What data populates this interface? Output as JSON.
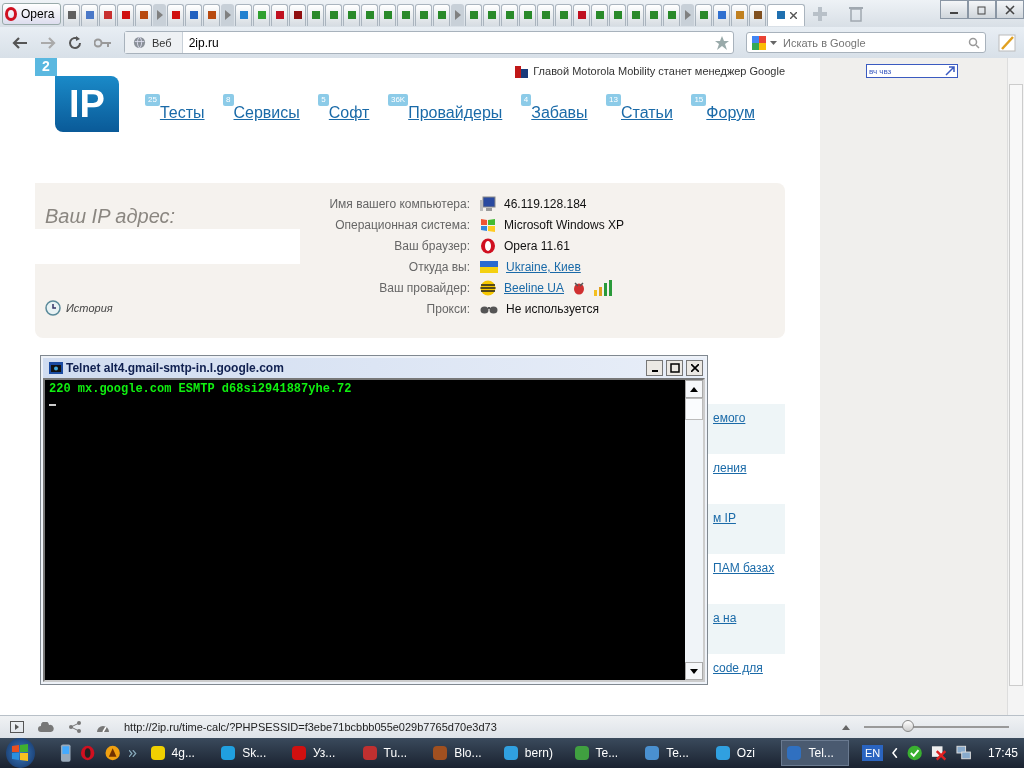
{
  "browser": {
    "menu_button": "Opera",
    "address_label": "Веб",
    "url": "2ip.ru",
    "search_placeholder": "Искать в Google",
    "tabs": [
      {
        "kind": "page",
        "color": "#606060",
        "selected": false
      },
      {
        "kind": "page",
        "color": "#4a78c8",
        "selected": false
      },
      {
        "kind": "page",
        "color": "#c83030",
        "selected": false
      },
      {
        "kind": "page",
        "color": "#d01010",
        "selected": false
      },
      {
        "kind": "page",
        "color": "#b84a10",
        "selected": false
      },
      {
        "kind": "stack",
        "color": "#808080",
        "selected": false
      },
      {
        "kind": "page",
        "color": "#d01010",
        "selected": false
      },
      {
        "kind": "page",
        "color": "#2060c0",
        "selected": false
      },
      {
        "kind": "page",
        "color": "#b84a10",
        "selected": false
      },
      {
        "kind": "stack",
        "color": "#808080",
        "selected": false
      },
      {
        "kind": "page",
        "color": "#2080d0",
        "selected": false
      },
      {
        "kind": "page",
        "color": "#30a030",
        "selected": false
      },
      {
        "kind": "page",
        "color": "#c01020",
        "selected": false
      },
      {
        "kind": "page",
        "color": "#901010",
        "selected": false
      },
      {
        "kind": "page",
        "color": "#2a8a2a",
        "selected": false
      },
      {
        "kind": "page",
        "color": "#2a8a2a",
        "selected": false
      },
      {
        "kind": "page",
        "color": "#2a8a2a",
        "selected": false
      },
      {
        "kind": "page",
        "color": "#2a8a2a",
        "selected": false
      },
      {
        "kind": "page",
        "color": "#2a8a2a",
        "selected": false
      },
      {
        "kind": "page",
        "color": "#2a8a2a",
        "selected": false
      },
      {
        "kind": "page",
        "color": "#2a8a2a",
        "selected": false
      },
      {
        "kind": "page",
        "color": "#2a8a2a",
        "selected": false
      },
      {
        "kind": "stack",
        "color": "#808080",
        "selected": false
      },
      {
        "kind": "page",
        "color": "#2a8a2a",
        "selected": false
      },
      {
        "kind": "page",
        "color": "#2a8a2a",
        "selected": false
      },
      {
        "kind": "page",
        "color": "#2a8a2a",
        "selected": false
      },
      {
        "kind": "page",
        "color": "#2a8a2a",
        "selected": false
      },
      {
        "kind": "page",
        "color": "#2a8a2a",
        "selected": false
      },
      {
        "kind": "page",
        "color": "#2a8a2a",
        "selected": false
      },
      {
        "kind": "page",
        "color": "#c01020",
        "selected": false
      },
      {
        "kind": "page",
        "color": "#2a8a2a",
        "selected": false
      },
      {
        "kind": "page",
        "color": "#2a8a2a",
        "selected": false
      },
      {
        "kind": "page",
        "color": "#2a8a2a",
        "selected": false
      },
      {
        "kind": "page",
        "color": "#2a8a2a",
        "selected": false
      },
      {
        "kind": "page",
        "color": "#2a8a2a",
        "selected": false
      },
      {
        "kind": "stack",
        "color": "#808080",
        "selected": false
      },
      {
        "kind": "page",
        "color": "#2a8a2a",
        "selected": false
      },
      {
        "kind": "page",
        "color": "#3070d0",
        "selected": false
      },
      {
        "kind": "page",
        "color": "#c08020",
        "selected": false
      },
      {
        "kind": "page",
        "color": "#805020",
        "selected": false
      },
      {
        "kind": "page",
        "color": "#2070b0",
        "selected": true
      }
    ]
  },
  "page": {
    "news": "Главой Motorola Mobility станет менеджер Google",
    "logo": {
      "badge": "2",
      "text": "IP"
    },
    "nav": [
      {
        "count": "25",
        "label": "Тесты"
      },
      {
        "count": "8",
        "label": "Сервисы"
      },
      {
        "count": "5",
        "label": "Софт"
      },
      {
        "count": "36K",
        "label": "Провайдеры"
      },
      {
        "count": "4",
        "label": "Забавы"
      },
      {
        "count": "13",
        "label": "Статьи"
      },
      {
        "count": "15",
        "label": "Форум"
      }
    ],
    "ip_panel": {
      "title": "Ваш IP адрес:",
      "history": "История",
      "rows": [
        {
          "label": "Имя вашего компьютера:",
          "value": "46.119.128.184",
          "kind": "text"
        },
        {
          "label": "Операционная система:",
          "value": "Microsoft Windows XP",
          "kind": "text"
        },
        {
          "label": "Ваш браузер:",
          "value": "Opera 11.61",
          "kind": "text"
        },
        {
          "label": "Откуда вы:",
          "value": "Ukraine, Киев",
          "kind": "link"
        },
        {
          "label": "Ваш провайдер:",
          "value": "Beeline UA",
          "kind": "link"
        },
        {
          "label": "Прокси:",
          "value": "Не используется",
          "kind": "text"
        }
      ]
    },
    "links": [
      {
        "text": "емого",
        "shaded": true
      },
      {
        "text": "ления",
        "shaded": false
      },
      {
        "text": "м IP",
        "shaded": true
      },
      {
        "text": "ПАМ базах",
        "shaded": false
      },
      {
        "text": "а на",
        "shaded": true
      },
      {
        "text": "code для",
        "shaded": false
      }
    ]
  },
  "sidebar": {
    "widget": "вч чвз"
  },
  "telnet": {
    "title": "Telnet alt4.gmail-smtp-in.l.google.com",
    "lines": [
      "220 mx.google.com ESMTP d68si2941887yhe.72"
    ]
  },
  "status_bar": {
    "url": "http://2ip.ru/time-calc/?PHPSESSID=f3ebe71bcbbb055e029b7765d70e3d73",
    "zoom": {
      "level": 0.3
    }
  },
  "taskbar": {
    "items": [
      {
        "label": "4g...",
        "selected": false
      },
      {
        "label": "Sk...",
        "selected": false
      },
      {
        "label": "Уз...",
        "selected": false
      },
      {
        "label": "Tu...",
        "selected": false
      },
      {
        "label": "Blo...",
        "selected": false
      },
      {
        "label": "bern)",
        "selected": false
      },
      {
        "label": "Te...",
        "selected": false
      },
      {
        "label": "Te...",
        "selected": false
      },
      {
        "label": "Ozi",
        "selected": false
      },
      {
        "label": "Tel...",
        "selected": true
      }
    ],
    "language": "EN",
    "clock": "17:45"
  }
}
